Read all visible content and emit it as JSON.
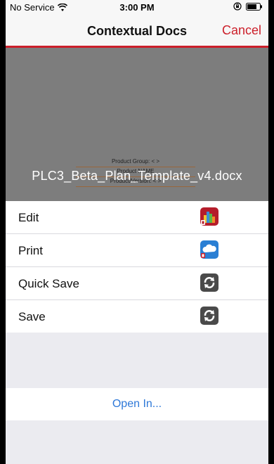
{
  "status": {
    "carrier": "No Service",
    "time": "3:00 PM"
  },
  "nav": {
    "title": "Contextual Docs",
    "cancel_label": "Cancel"
  },
  "preview": {
    "file_name": "PLC3_Beta_Plan_Template_v4.docx",
    "doc_lines": [
      "Product Group: < >",
      "Product NAME",
      "Product/Version: < >"
    ]
  },
  "actions": [
    {
      "label": "Edit",
      "icon": "office-docs-icon"
    },
    {
      "label": "Print",
      "icon": "breezy-print-icon"
    },
    {
      "label": "Quick Save",
      "icon": "sync-save-icon"
    },
    {
      "label": "Save",
      "icon": "sync-save-icon"
    }
  ],
  "open_in": {
    "label": "Open In..."
  },
  "colors": {
    "accent_red": "#cc1f2a",
    "link_blue": "#2e78d8",
    "preview_gray": "#7d7d7d"
  }
}
